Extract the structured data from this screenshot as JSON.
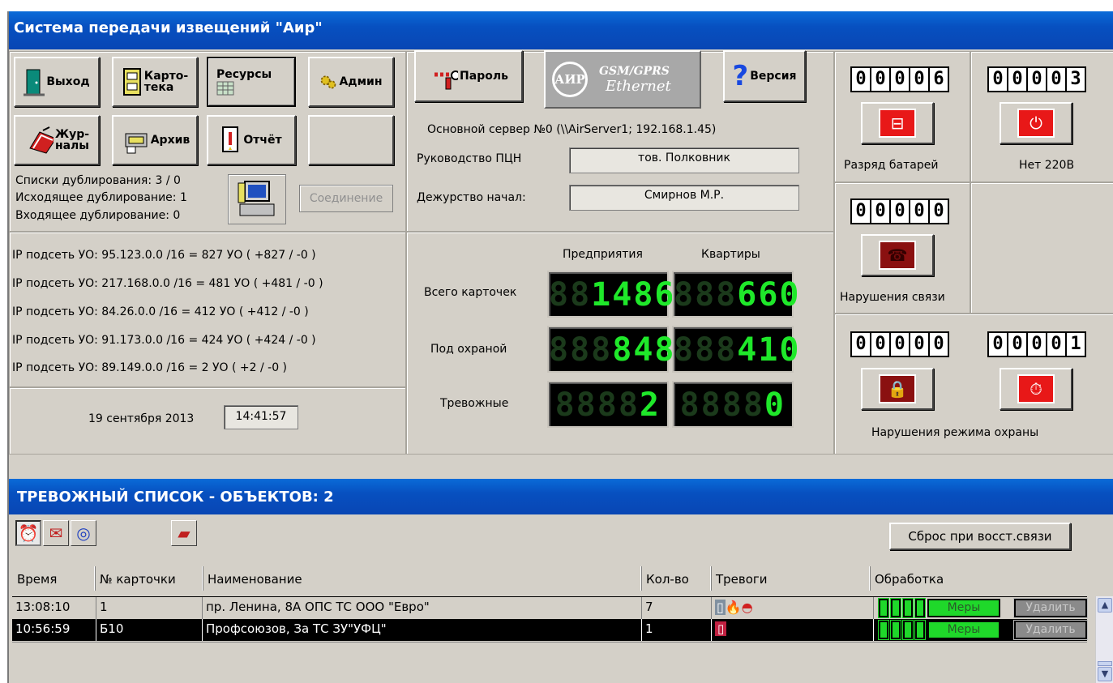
{
  "window": {
    "title": "Система передачи извещений \"Аир\""
  },
  "toolbar": {
    "exit": "Выход",
    "cards": "Карто-\nтека",
    "resources": "Ресурсы",
    "admin": "Админ",
    "journals": "Жур-\nналы",
    "archive": "Архив",
    "report": "Отчёт",
    "password": "Пароль",
    "version": "Версия",
    "logo_line1": "GSM/GPRS",
    "logo_line2": "Ethernet",
    "logo_mark": "АИР"
  },
  "duplication": {
    "lists": "Списки дублирования: 3 / 0",
    "outgoing": "Исходящее дублирование: 1",
    "incoming": "Входящее дублирование: 0",
    "connect_button": "Соединение"
  },
  "server": {
    "main": "Основной сервер №0 (\\\\AirServer1; 192.168.1.45)",
    "management_label": "Руководство ПЦН",
    "management_value": "тов. Полковник",
    "duty_label": "Дежурство  начал:",
    "duty_value": "Смирнов М.Р."
  },
  "subnets": [
    "IP подсеть УО:  95.123.0.0 /16 = 827 УО ( +827 / -0 )",
    "IP подсеть УО:  217.168.0.0 /16 = 481 УО ( +481 / -0 )",
    "IP подсеть УО:  84.26.0.0 /16 = 412 УО ( +412 / -0 )",
    "IP подсеть УО:  91.173.0.0 /16 = 424 УО ( +424 / -0 )",
    "IP подсеть УО:  89.149.0.0 /16 = 2 УО ( +2 / -0 )"
  ],
  "clock": {
    "date": "19 сентября 2013",
    "time": "14:41:57"
  },
  "stats": {
    "col_enterprises": "Предприятия",
    "col_apartments": "Квартиры",
    "row_total": "Всего карточек",
    "row_guarded": "Под охраной",
    "row_alarm": "Тревожные",
    "total_ent": {
      "ghost": "88",
      "value": "1486"
    },
    "total_apt": {
      "ghost": "888",
      "value": "660"
    },
    "guard_ent": {
      "ghost": "888",
      "value": "848"
    },
    "guard_apt": {
      "ghost": "888",
      "value": "410"
    },
    "alarm_ent": {
      "ghost": "8888",
      "value": "2"
    },
    "alarm_apt": {
      "ghost": "8888",
      "value": "0"
    }
  },
  "indicators": {
    "battery_count": "00006",
    "battery_label": "Разряд батарей",
    "power_count": "00003",
    "power_label": "Нет 220В",
    "link_count": "00000",
    "link_label": "Нарушения связи",
    "mode1_count": "00000",
    "mode2_count": "00001",
    "mode_label": "Нарушения режима охраны"
  },
  "alarm_list": {
    "title": "ТРЕВОЖНЫЙ СПИСОК - ОБЪЕКТОВ: 2",
    "reset_button": "Сброс при восст.связи",
    "columns": [
      "Время",
      "№ карточки",
      "Наименование",
      "Кол-во",
      "Тревоги",
      "Обработка"
    ],
    "rows": [
      {
        "time": "13:08:10",
        "card": "1",
        "name": "пр. Ленина, 8А    ОПС ТС ООО \"Евро\"",
        "count": "7",
        "measures": "Меры",
        "delete": "Удалить"
      },
      {
        "time": "10:56:59",
        "card": "Б10",
        "name": "Профсоюзов,  За  ТС  ЗУ\"УФЦ\"",
        "count": "1",
        "measures": "Меры",
        "delete": "Удалить"
      }
    ]
  },
  "colors": {
    "title_blue": "#0750c0",
    "led_green": "#1fe82a",
    "alarm_red": "#e01818",
    "window_gray": "#d4d0c8"
  }
}
